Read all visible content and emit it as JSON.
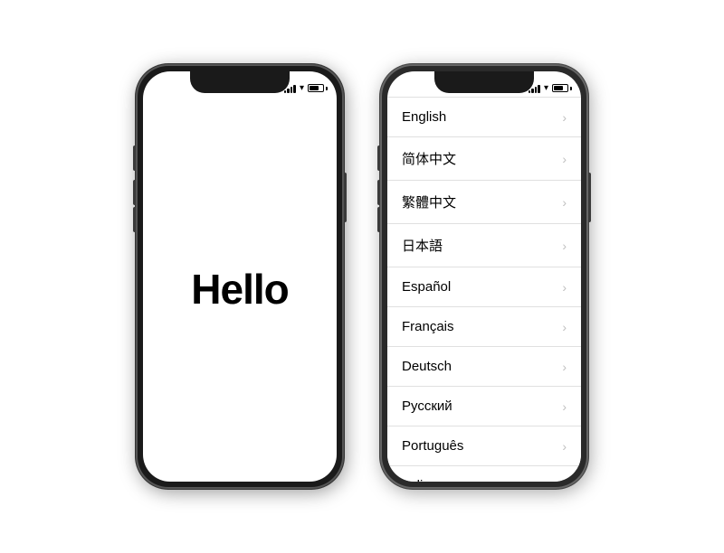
{
  "phone1": {
    "hello_text": "Hello"
  },
  "phone2": {
    "languages": [
      "English",
      "简体中文",
      "繁體中文",
      "日本語",
      "Español",
      "Français",
      "Deutsch",
      "Русский",
      "Português",
      "Italiano"
    ]
  },
  "status": {
    "chevron": "›"
  }
}
